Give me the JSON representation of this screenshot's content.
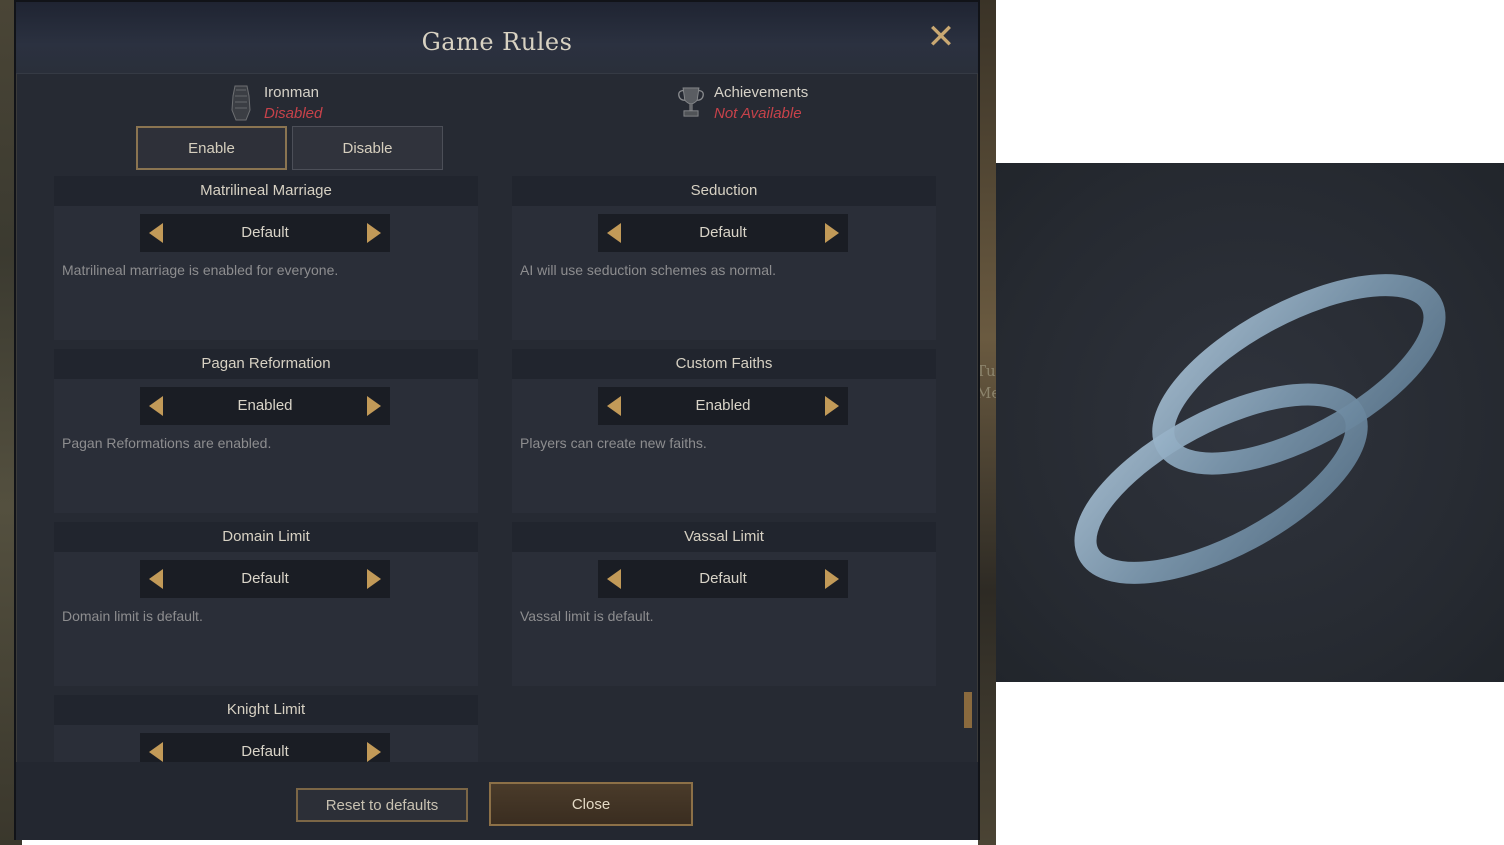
{
  "window": {
    "title": "Game Rules",
    "close_icon": "close-icon"
  },
  "status": {
    "ironman": {
      "label": "Ironman",
      "value": "Disabled",
      "icon": "gauntlet-icon"
    },
    "achievements": {
      "label": "Achievements",
      "value": "Not Available",
      "icon": "trophy-icon"
    }
  },
  "toggle": {
    "enable_label": "Enable",
    "disable_label": "Disable"
  },
  "rules": [
    {
      "title": "Matrilineal Marriage",
      "value": "Default",
      "desc": "Matrilineal marriage is enabled for everyone."
    },
    {
      "title": "Seduction",
      "value": "Default",
      "desc": "AI will use seduction schemes as normal."
    },
    {
      "title": "Pagan Reformation",
      "value": "Enabled",
      "desc": "Pagan Reformations are enabled."
    },
    {
      "title": "Custom Faiths",
      "value": "Enabled",
      "desc": "Players can create new faiths."
    },
    {
      "title": "Domain Limit",
      "value": "Default",
      "desc": "Domain limit is default."
    },
    {
      "title": "Vassal Limit",
      "value": "Default",
      "desc": "Vassal limit is default."
    },
    {
      "title": "Knight Limit",
      "value": "Default",
      "desc": ""
    }
  ],
  "footer": {
    "reset_label": "Reset to defaults",
    "close_label": "Close"
  },
  "background_map_text": [
    "Tu",
    "Me"
  ],
  "zoom": {
    "icon": "wedding-rings-icon"
  },
  "colors": {
    "accent_gold": "#c29a58",
    "status_red": "#c7424a",
    "panel_bg": "#262a33"
  }
}
